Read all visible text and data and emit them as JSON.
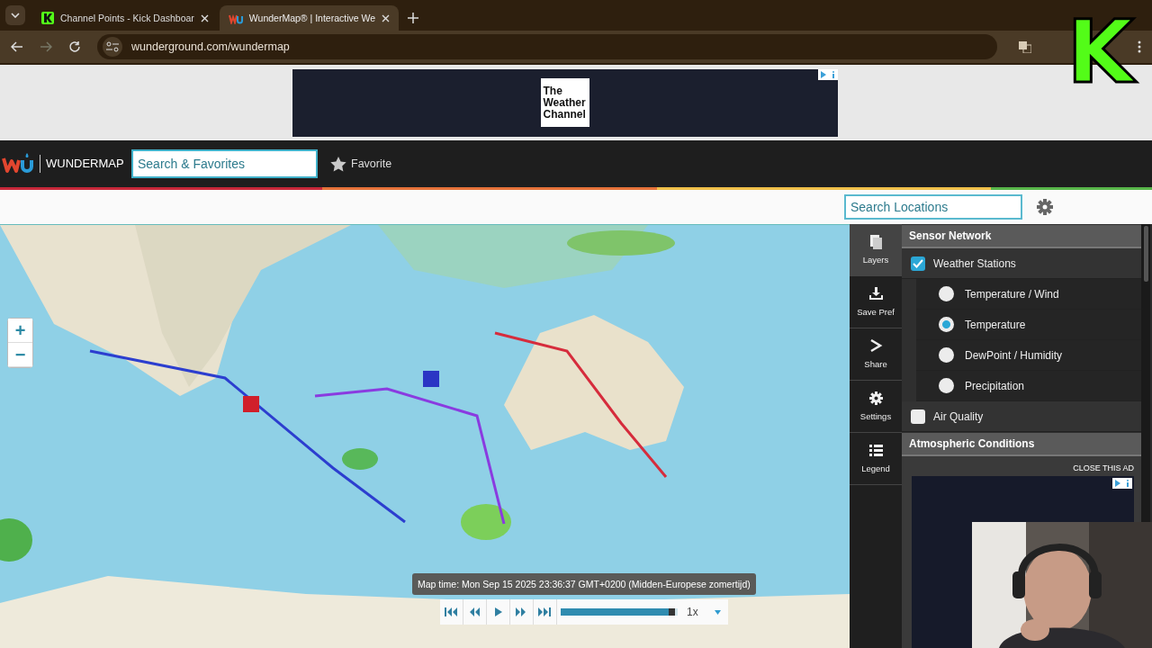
{
  "browser": {
    "tabs": [
      {
        "title": "Channel Points - Kick Dashboar",
        "selected": false
      },
      {
        "title": "WunderMap® | Interactive We",
        "selected": true
      }
    ],
    "address": "wunderground.com/wundermap"
  },
  "top_ad": {
    "logo_lines": [
      "The",
      "Weather",
      "Channel"
    ]
  },
  "header": {
    "brand": "WUNDERMAP",
    "search": {
      "placeholder": "Search & Favorites"
    },
    "favorite": "Favorite"
  },
  "location_search": {
    "placeholder": "Search Locations"
  },
  "map": {
    "zoom_in": "+",
    "zoom_out": "−"
  },
  "side_tabs": [
    {
      "label": "Layers",
      "kind": "layers",
      "selected": true
    },
    {
      "label": "Save Pref",
      "kind": "save",
      "selected": false
    },
    {
      "label": "Share",
      "kind": "share",
      "selected": false
    },
    {
      "label": "Settings",
      "kind": "settings",
      "selected": false
    },
    {
      "label": "Legend",
      "kind": "legend",
      "selected": false
    }
  ],
  "layers": [
    {
      "title": "Sensor Network",
      "items": [
        {
          "kind": "checkbox",
          "label": "Weather Stations",
          "checked": true
        },
        {
          "kind": "radio",
          "label": "Temperature / Wind",
          "selected": false
        },
        {
          "kind": "radio",
          "label": "Temperature",
          "selected": true
        },
        {
          "kind": "radio",
          "label": "DewPoint / Humidity",
          "selected": false
        },
        {
          "kind": "radio",
          "label": "Precipitation",
          "selected": false
        },
        {
          "kind": "checkbox",
          "label": "Air Quality",
          "checked": false
        }
      ]
    },
    {
      "title": "Atmospheric Conditions"
    }
  ],
  "panel_ad": {
    "close": "CLOSE THIS AD"
  },
  "playback": {
    "map_time": "Map time: Mon Sep 15 2025 23:36:37 GMT+0200 (Midden-Europese zomertijd)",
    "level": 0.98,
    "speed": "1x"
  },
  "overlay": {
    "logo": "K"
  }
}
